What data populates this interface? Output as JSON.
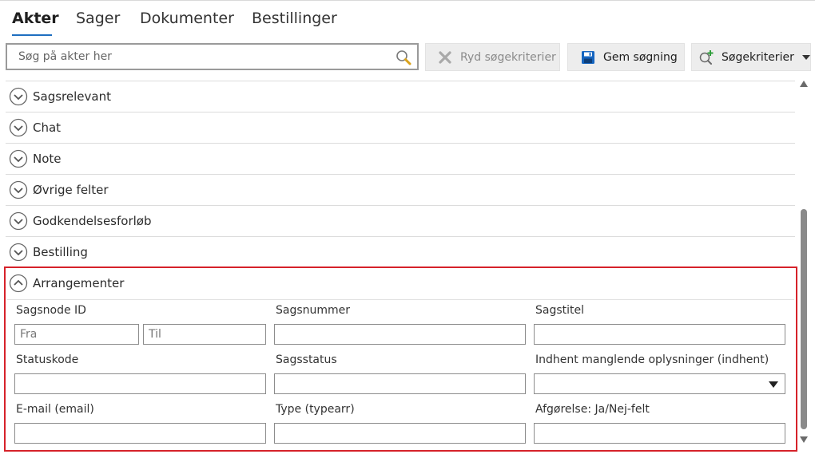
{
  "tabs": [
    {
      "label": "Akter",
      "active": true
    },
    {
      "label": "Sager",
      "active": false
    },
    {
      "label": "Dokumenter",
      "active": false
    },
    {
      "label": "Bestillinger",
      "active": false
    }
  ],
  "search": {
    "placeholder": "Søg på akter her",
    "icon": "search-icon"
  },
  "toolbar": {
    "clear_label": "Ryd søgekriterier",
    "save_label": "Gem søgning",
    "criteria_label": "Søgekriterier"
  },
  "sections": [
    {
      "label": "Sagsrelevant",
      "expanded": false
    },
    {
      "label": "Chat",
      "expanded": false
    },
    {
      "label": "Note",
      "expanded": false
    },
    {
      "label": "Øvrige felter",
      "expanded": false
    },
    {
      "label": "Godkendelsesforløb",
      "expanded": false
    },
    {
      "label": "Bestilling",
      "expanded": false
    }
  ],
  "expanded_section": {
    "label": "Arrangementer",
    "fields": {
      "sagsnode_id": {
        "label": "Sagsnode ID",
        "from_placeholder": "Fra",
        "to_placeholder": "Til"
      },
      "sagsnummer": {
        "label": "Sagsnummer",
        "value": ""
      },
      "sagstitel": {
        "label": "Sagstitel",
        "value": ""
      },
      "statuskode": {
        "label": "Statuskode",
        "value": ""
      },
      "sagsstatus": {
        "label": "Sagsstatus",
        "value": ""
      },
      "indhent": {
        "label": "Indhent manglende oplysninger (indhent)",
        "value": ""
      },
      "email": {
        "label": "E-mail (email)",
        "value": ""
      },
      "type": {
        "label": "Type (typearr)",
        "value": ""
      },
      "afgoerelse": {
        "label": "Afgørelse: Ja/Nej-felt",
        "value": ""
      }
    }
  },
  "colors": {
    "accent": "#1e6fc0",
    "highlight_border": "#d6222a",
    "save_icon": "#1565c0"
  }
}
